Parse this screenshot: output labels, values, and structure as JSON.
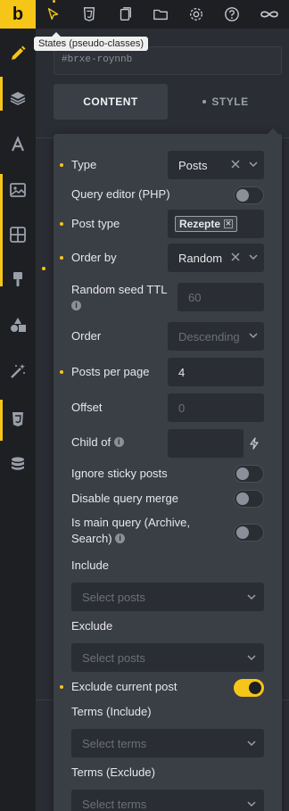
{
  "brand": {
    "logo_letter": "b",
    "accent": "#f5c518"
  },
  "topbar": {
    "icons": [
      "pointer-icon",
      "css3-icon",
      "pages-icon",
      "folder-icon",
      "gear-icon",
      "help-icon",
      "infinity-icon"
    ],
    "tooltip": "States (pseudo-classes)"
  },
  "sidebar": {
    "icons": [
      "pencil-icon",
      "layers-icon",
      "typography-icon",
      "image-icon",
      "layout-icon",
      "brush-icon",
      "shapes-icon",
      "magic-wand-icon",
      "css3-icon",
      "database-icon"
    ]
  },
  "element_id": "#brxe-roynnb",
  "tabs": {
    "content": "CONTENT",
    "style": "STYLE"
  },
  "query": {
    "type": {
      "label": "Type",
      "value": "Posts"
    },
    "query_editor": {
      "label": "Query editor (PHP)"
    },
    "post_type": {
      "label": "Post type",
      "tag": "Rezepte"
    },
    "order_by": {
      "label": "Order by",
      "value": "Random"
    },
    "random_seed": {
      "label": "Random seed TTL",
      "placeholder": "60"
    },
    "order": {
      "label": "Order",
      "value": "Descending"
    },
    "posts_per_page": {
      "label": "Posts per page",
      "value": "4"
    },
    "offset": {
      "label": "Offset",
      "placeholder": "0"
    },
    "child_of": {
      "label": "Child of"
    },
    "ignore_sticky": {
      "label": "Ignore sticky posts"
    },
    "disable_merge": {
      "label": "Disable query merge"
    },
    "main_query": {
      "label_line1": "Is main query (Archive,",
      "label_line2": "Search)"
    },
    "include": {
      "label": "Include",
      "placeholder": "Select posts"
    },
    "exclude": {
      "label": "Exclude",
      "placeholder": "Select posts"
    },
    "exclude_current": {
      "label": "Exclude current post"
    },
    "terms_include": {
      "label": "Terms (Include)",
      "placeholder": "Select terms"
    },
    "terms_exclude": {
      "label": "Terms (Exclude)",
      "placeholder": "Select terms"
    }
  }
}
